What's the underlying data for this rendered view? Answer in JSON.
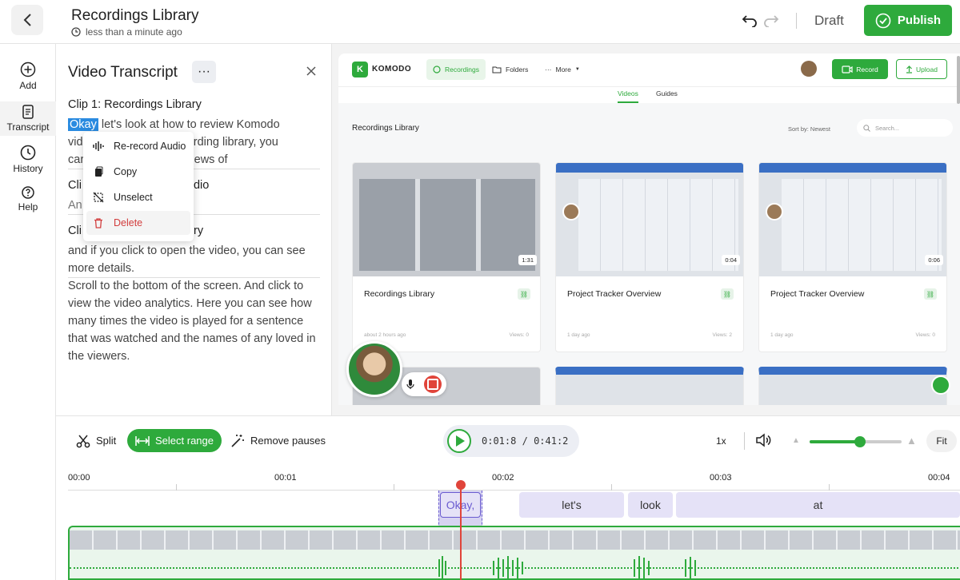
{
  "header": {
    "title": "Recordings Library",
    "saved_status": "less than a minute ago",
    "draft_label": "Draft",
    "publish_label": "Publish"
  },
  "leftnav": {
    "items": [
      {
        "label": "Add",
        "icon": "add-icon"
      },
      {
        "label": "Transcript",
        "icon": "transcript-icon"
      },
      {
        "label": "History",
        "icon": "history-icon"
      },
      {
        "label": "Help",
        "icon": "help-icon"
      }
    ]
  },
  "transcript": {
    "title": "Video Transcript",
    "more": "···",
    "clip1_title": "Clip 1: Recordings Library",
    "clip1_highlight": "Okay",
    "clip1_text_rest": "let's look at how to review Komodo",
    "clip1_line2_start": "vid",
    "clip1_line2_end": "recording library, you",
    "clip1_line3_start": "car",
    "clip1_line3_end": "views of",
    "clip2_start": "Cli",
    "clip2_end": "udio",
    "clip2_text_start": "An",
    "clip3_start": "Cli",
    "clip3_end": "ary",
    "clip3_para1": "and if you click to open the video, you can see more details.",
    "clip3_para2": "Scroll to the bottom of the screen. And click to view the video analytics. Here you can see how many times the video is played for a sentence that was watched and the names of any loved in the viewers."
  },
  "context_menu": {
    "items": [
      {
        "label": "Re-record Audio",
        "icon": "audio-wave-icon"
      },
      {
        "label": "Copy",
        "icon": "copy-icon"
      },
      {
        "label": "Unselect",
        "icon": "unselect-icon"
      },
      {
        "label": "Delete",
        "icon": "trash-icon"
      }
    ]
  },
  "preview": {
    "brand": "KOMODO",
    "brand_letter": "K",
    "nav": [
      "Recordings",
      "Folders",
      "More"
    ],
    "record_label": "Record",
    "upload_label": "Upload",
    "tabs": [
      "Videos",
      "Guides"
    ],
    "library_title": "Recordings Library",
    "sort_label": "Sort by: Newest",
    "search_placeholder": "Search...",
    "cards": [
      {
        "title": "Recordings Library",
        "duration": "1:31",
        "age": "about 2 hours ago",
        "views": "Views: 0"
      },
      {
        "title": "Project Tracker Overview",
        "duration": "0:04",
        "age": "1 day ago",
        "views": "Views: 2"
      },
      {
        "title": "Project Tracker Overview",
        "duration": "0:06",
        "age": "1 day ago",
        "views": "Views: 0"
      }
    ]
  },
  "toolbar": {
    "split_label": "Split",
    "select_range_label": "Select range",
    "remove_pauses_label": "Remove pauses",
    "current_time": "0:01:8",
    "total_time": "0:41:2",
    "time_separator": "/",
    "speed_label": "1x",
    "zoom_level": 0.55,
    "fit_label": "Fit"
  },
  "timeline": {
    "ticks": [
      "00:00",
      "00:01",
      "00:02",
      "00:03",
      "00:04"
    ],
    "words": [
      "Okay,",
      "let's",
      "look",
      "at"
    ]
  },
  "colors": {
    "accent": "#2eaa3c",
    "highlight": "#2a8be0",
    "danger": "#d23d3d",
    "word_bg": "#e5e2f7",
    "selection": "#6a5bd0",
    "playhead": "#e0443a"
  }
}
